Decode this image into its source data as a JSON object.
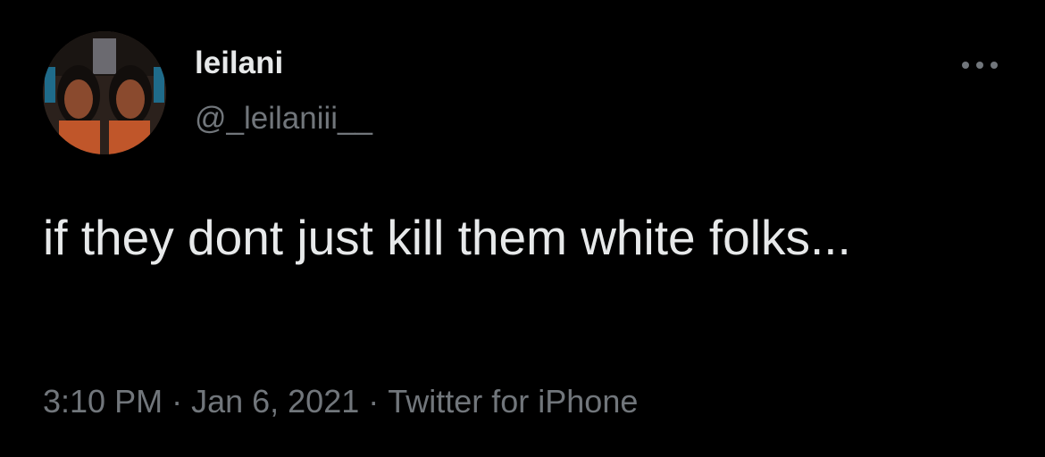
{
  "author": {
    "display_name": "leilani",
    "handle": "@_leilaniii__",
    "avatar_icon": "avatar-photo"
  },
  "tweet": {
    "text": "if they dont just kill them white folks...",
    "time": "3:10 PM",
    "separator": "·",
    "date": "Jan 6, 2021",
    "source": "Twitter for iPhone"
  },
  "icons": {
    "more": "more-horizontal-icon"
  },
  "colors": {
    "background": "#000000",
    "primary_text": "#e7e9ea",
    "secondary_text": "#71767b"
  }
}
